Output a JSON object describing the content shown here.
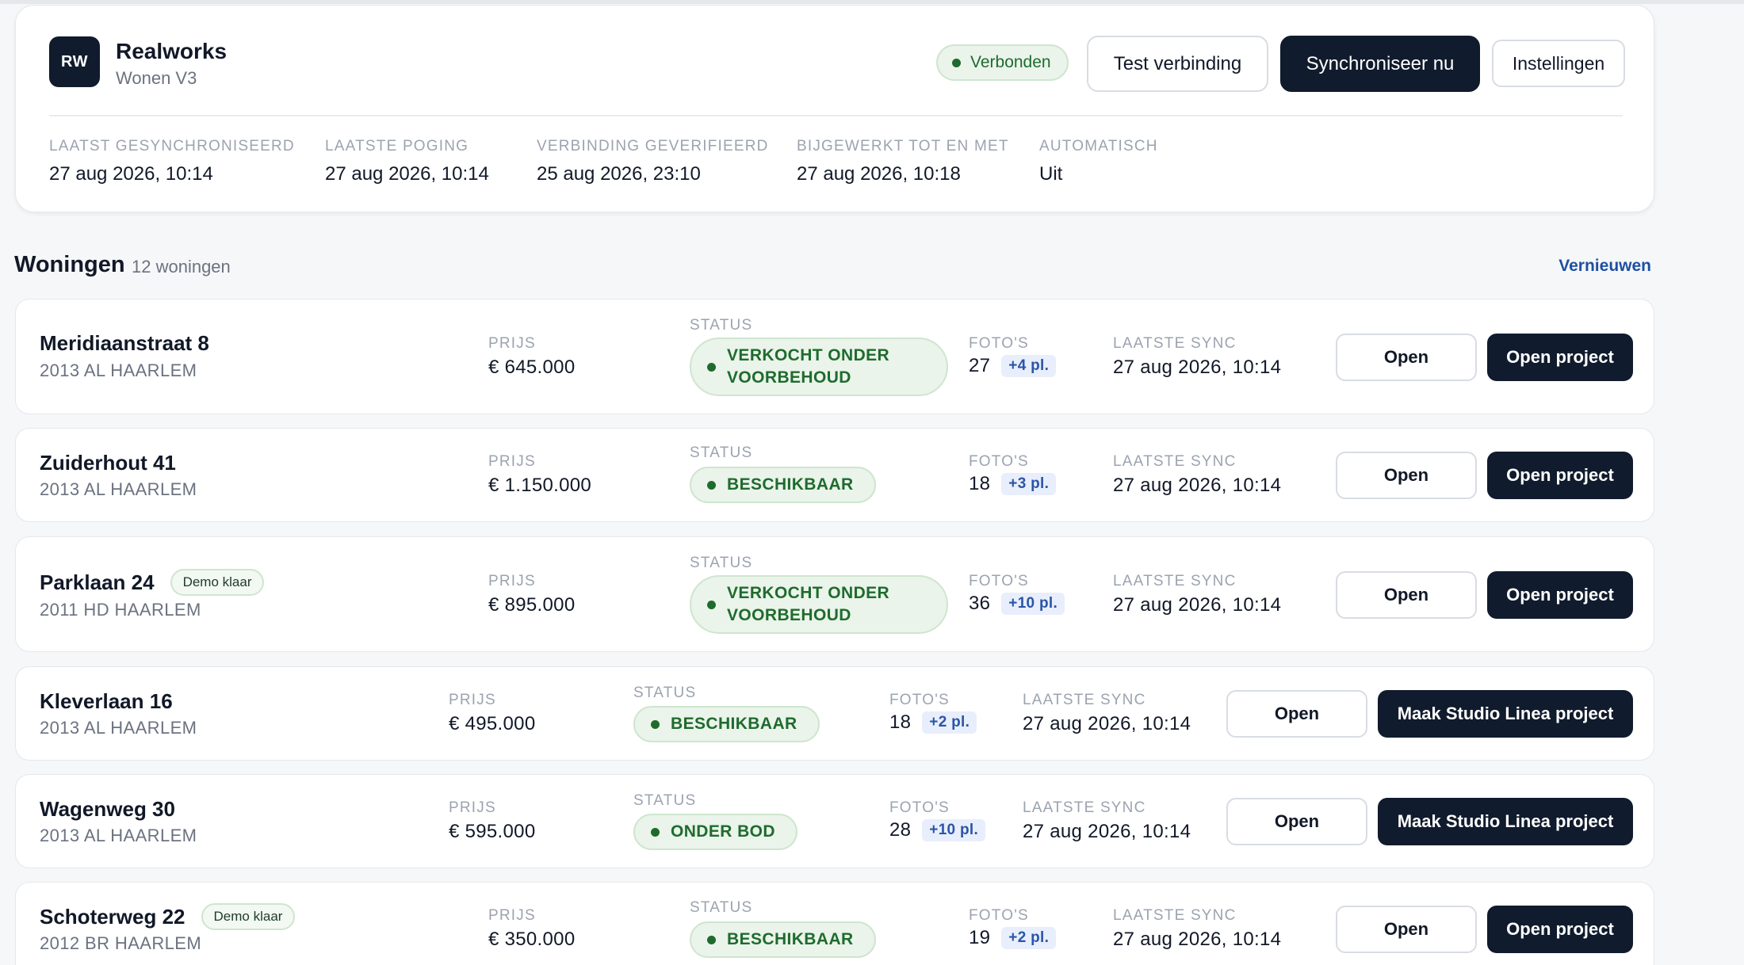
{
  "integration": {
    "logo_text": "RW",
    "name": "Realworks",
    "subtitle": "Wonen V3",
    "status": "Verbonden",
    "buttons": {
      "test": "Test verbinding",
      "sync": "Synchroniseer nu",
      "settings": "Instellingen"
    },
    "stats": [
      {
        "label": "Laatst gesynchroniseerd",
        "value": "27 aug 2026, 10:14"
      },
      {
        "label": "Laatste poging",
        "value": "27 aug 2026, 10:14"
      },
      {
        "label": "Verbinding geverifieerd",
        "value": "25 aug 2026, 23:10"
      },
      {
        "label": "Bijgewerkt tot en met",
        "value": "27 aug 2026, 10:18"
      },
      {
        "label": "Automatisch",
        "value": "Uit"
      }
    ]
  },
  "listings": {
    "title": "Woningen",
    "count": "12 woningen",
    "refresh": "Vernieuwen",
    "labels": {
      "price": "Prijs",
      "status": "Status",
      "photos": "Foto's",
      "last_sync": "Laatste sync"
    },
    "items": [
      {
        "name": "Meridiaanstraat 8",
        "address": "2013 AL HAARLEM",
        "badge": "",
        "price": "€ 645.000",
        "status_line1": "VERKOCHT ONDER",
        "status_line2": "VOORBEHOUD",
        "photos": "27",
        "photos_extra": "+4 pl.",
        "last_sync": "27 aug 2026, 10:14",
        "open": "Open",
        "action": "Open project"
      },
      {
        "name": "Zuiderhout 41",
        "address": "2013 AL HAARLEM",
        "badge": "",
        "price": "€ 1.150.000",
        "status_line1": "BESCHIKBAAR",
        "status_line2": "",
        "photos": "18",
        "photos_extra": "+3 pl.",
        "last_sync": "27 aug 2026, 10:14",
        "open": "Open",
        "action": "Open project"
      },
      {
        "name": "Parklaan 24",
        "address": "2011 HD HAARLEM",
        "badge": "Demo klaar",
        "price": "€ 895.000",
        "status_line1": "VERKOCHT ONDER",
        "status_line2": "VOORBEHOUD",
        "photos": "36",
        "photos_extra": "+10 pl.",
        "last_sync": "27 aug 2026, 10:14",
        "open": "Open",
        "action": "Open project"
      },
      {
        "name": "Kleverlaan 16",
        "address": "2013 AL HAARLEM",
        "badge": "",
        "price": "€ 495.000",
        "status_line1": "BESCHIKBAAR",
        "status_line2": "",
        "photos": "18",
        "photos_extra": "+2 pl.",
        "last_sync": "27 aug 2026, 10:14",
        "open": "Open",
        "action": "Maak Studio Linea project"
      },
      {
        "name": "Wagenweg 30",
        "address": "2013 AL HAARLEM",
        "badge": "",
        "price": "€ 595.000",
        "status_line1": "ONDER BOD",
        "status_line2": "",
        "photos": "28",
        "photos_extra": "+10 pl.",
        "last_sync": "27 aug 2026, 10:14",
        "open": "Open",
        "action": "Maak Studio Linea project"
      },
      {
        "name": "Schoterweg 22",
        "address": "2012 BR HAARLEM",
        "badge": "Demo klaar",
        "price": "€ 350.000",
        "status_line1": "BESCHIKBAAR",
        "status_line2": "",
        "photos": "19",
        "photos_extra": "+2 pl.",
        "last_sync": "27 aug 2026, 10:14",
        "open": "Open",
        "action": "Open project"
      }
    ]
  },
  "colors": {
    "primary_dark": "#101b2d",
    "status_green": "#1f6b2e",
    "status_bg": "#eaf4ea",
    "link_blue": "#1f4fa3",
    "photo_tag_blue": "#2a55a8"
  }
}
